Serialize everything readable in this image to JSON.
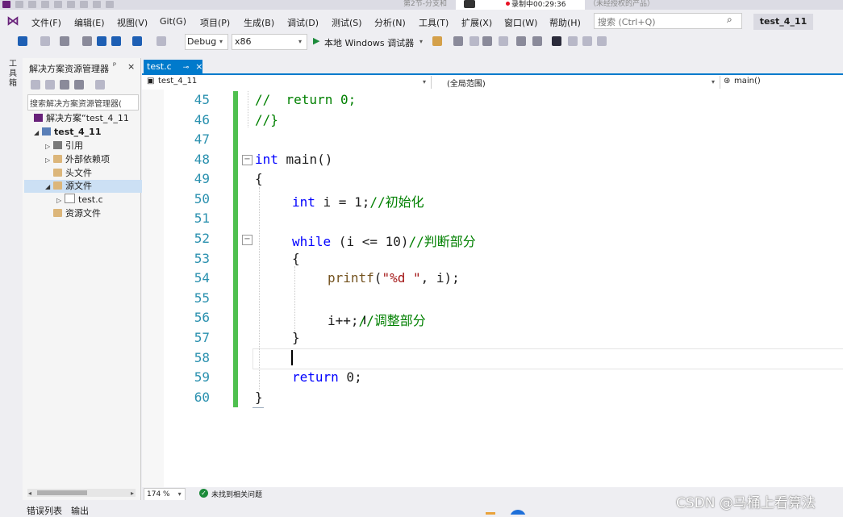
{
  "window": {
    "recording_label": "录制中00:29:36",
    "left_faded_title": "第2节-分支和",
    "right_faded_title": "（未经授权的产品）"
  },
  "menu": {
    "items": [
      "文件(F)",
      "编辑(E)",
      "视图(V)",
      "Git(G)",
      "项目(P)",
      "生成(B)",
      "调试(D)",
      "测试(S)",
      "分析(N)",
      "工具(T)",
      "扩展(X)",
      "窗口(W)",
      "帮助(H)"
    ],
    "search_placeholder": "搜索 (Ctrl+Q)",
    "solution_name": "test_4_11"
  },
  "toolbar": {
    "configuration": "Debug",
    "platform": "x86",
    "run_label": "本地 Windows 调试器"
  },
  "toolbox": {
    "label": "工具箱"
  },
  "solution_explorer": {
    "title": "解决方案资源管理器",
    "search_text": "搜索解决方案资源管理器(",
    "tree": [
      {
        "label": "解决方案“test_4_11",
        "icon": "solution-icon",
        "expander": ""
      },
      {
        "label": "test_4_11",
        "icon": "project-icon",
        "expander": "◢"
      },
      {
        "label": "引用",
        "icon": "references-icon",
        "expander": "▷"
      },
      {
        "label": "外部依赖项",
        "icon": "folder-icon",
        "expander": "▷"
      },
      {
        "label": "头文件",
        "icon": "folder-icon",
        "expander": ""
      },
      {
        "label": "源文件",
        "icon": "folder-icon",
        "expander": "◢"
      },
      {
        "label": "test.c",
        "icon": "c-file-icon",
        "expander": "▷"
      },
      {
        "label": "资源文件",
        "icon": "folder-icon",
        "expander": ""
      }
    ],
    "selected_index": 5
  },
  "editor": {
    "tab_label": "test.c",
    "nav_project": "test_4_11",
    "nav_scope": "(全局范围)",
    "nav_member": "main()",
    "line_numbers": [
      "45",
      "46",
      "47",
      "48",
      "49",
      "50",
      "51",
      "52",
      "53",
      "54",
      "55",
      "56",
      "57",
      "58",
      "59",
      "60"
    ],
    "code": {
      "l45_comment": "//  return 0;",
      "l46_comment": "//}",
      "l48_kw": "int",
      "l48_rest": " main()",
      "l49": "{",
      "l50_kw": "int",
      "l50_rest": " i = 1;",
      "l50_comment": "//初始化",
      "l52_kw": "while",
      "l52_rest": " (i <= 10)",
      "l52_comment": "//判断部分",
      "l53": "{",
      "l54_fn": "printf",
      "l54_open": "(",
      "l54_str": "\"%d \"",
      "l54_rest": ", i);",
      "l56_code": "i++;",
      "l56_comment": "//调整部分",
      "l57": "}",
      "l59_kw": "return",
      "l59_rest": " 0;",
      "l60": "}"
    },
    "zoom": "174 %",
    "issues": "未找到相关问题"
  },
  "bottom_tabs": [
    "错误列表",
    "输出"
  ],
  "watermark": "CSDN @马桶上看算法",
  "colors": {
    "accent": "#007acc",
    "keyword": "#0000ff",
    "comment": "#008000",
    "string": "#a31515",
    "line_number": "#2b91af",
    "change_bar": "#4fc04f"
  }
}
